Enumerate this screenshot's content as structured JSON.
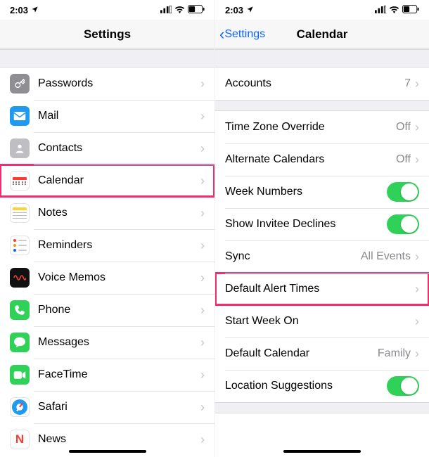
{
  "status": {
    "time": "2:03",
    "location_glyph": "➤",
    "signal_glyph": "▪▪▪▫",
    "wifi_glyph": "⎋",
    "battery_glyph": "▢"
  },
  "left": {
    "title": "Settings",
    "items": [
      {
        "id": "passwords",
        "label": "Passwords",
        "icon": "key-icon"
      },
      {
        "id": "mail",
        "label": "Mail",
        "icon": "mail-icon"
      },
      {
        "id": "contacts",
        "label": "Contacts",
        "icon": "contacts-icon"
      },
      {
        "id": "calendar",
        "label": "Calendar",
        "icon": "calendar-icon",
        "highlight": true
      },
      {
        "id": "notes",
        "label": "Notes",
        "icon": "notes-icon"
      },
      {
        "id": "reminders",
        "label": "Reminders",
        "icon": "reminders-icon"
      },
      {
        "id": "voicememos",
        "label": "Voice Memos",
        "icon": "voice-memos-icon"
      },
      {
        "id": "phone",
        "label": "Phone",
        "icon": "phone-icon"
      },
      {
        "id": "messages",
        "label": "Messages",
        "icon": "messages-icon"
      },
      {
        "id": "facetime",
        "label": "FaceTime",
        "icon": "facetime-icon"
      },
      {
        "id": "safari",
        "label": "Safari",
        "icon": "safari-icon"
      },
      {
        "id": "news",
        "label": "News",
        "icon": "news-icon"
      }
    ]
  },
  "right": {
    "back": "Settings",
    "title": "Calendar",
    "groups": [
      [
        {
          "id": "accounts",
          "label": "Accounts",
          "value": "7",
          "type": "link"
        }
      ],
      [
        {
          "id": "tz",
          "label": "Time Zone Override",
          "value": "Off",
          "type": "link"
        },
        {
          "id": "altcal",
          "label": "Alternate Calendars",
          "value": "Off",
          "type": "link"
        },
        {
          "id": "weeknum",
          "label": "Week Numbers",
          "on": true,
          "type": "toggle"
        },
        {
          "id": "declines",
          "label": "Show Invitee Declines",
          "on": true,
          "type": "toggle"
        },
        {
          "id": "sync",
          "label": "Sync",
          "value": "All Events",
          "type": "link"
        },
        {
          "id": "alerts",
          "label": "Default Alert Times",
          "value": "",
          "type": "link",
          "highlight": true
        },
        {
          "id": "startwk",
          "label": "Start Week On",
          "value": "",
          "type": "link"
        },
        {
          "id": "defcal",
          "label": "Default Calendar",
          "value": "Family",
          "type": "link"
        },
        {
          "id": "locsug",
          "label": "Location Suggestions",
          "on": true,
          "type": "toggle"
        }
      ]
    ]
  },
  "chevron": "›",
  "signal_svg_bars": [
    6,
    9,
    12,
    15
  ]
}
